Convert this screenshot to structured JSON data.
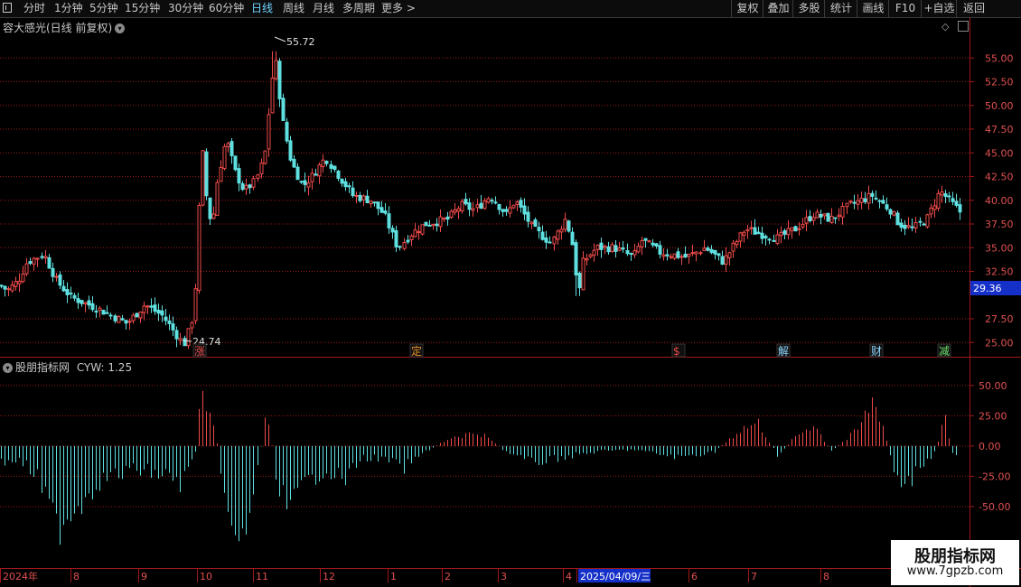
{
  "toolbar": {
    "periods": [
      "分时",
      "1分钟",
      "5分钟",
      "15分钟",
      "30分钟",
      "60分钟",
      "日线",
      "周线",
      "月线",
      "多周期",
      "更多 >"
    ],
    "active_period": "日线",
    "right_buttons": [
      "复权",
      "叠加",
      "多股",
      "统计",
      "画线",
      "F10",
      "+自选",
      "返回"
    ]
  },
  "main_panel": {
    "title": "容大感光(日线 前复权)",
    "high_label": "55.72",
    "low_label": "24.74",
    "current_price": "29.36",
    "y_ticks": [
      "55.00",
      "52.50",
      "50.00",
      "47.50",
      "45.00",
      "42.50",
      "40.00",
      "37.50",
      "35.00",
      "32.50",
      "27.50",
      "25.00"
    ],
    "events": [
      {
        "label": "涨",
        "color": "#e84a4a"
      },
      {
        "label": "定",
        "color": "#e8902a"
      },
      {
        "label": "$",
        "color": "#e84a4a"
      },
      {
        "label": "解",
        "color": "#8ed8ff"
      },
      {
        "label": "财",
        "color": "#8ed8ff"
      },
      {
        "label": "减",
        "color": "#6ce46c"
      }
    ]
  },
  "indicator_panel": {
    "title": "股朋指标网",
    "value_label": "CYW: 1.25",
    "y_ticks": [
      "50.00",
      "25.00",
      "0.00",
      "-25.00",
      "-50.00"
    ]
  },
  "time_axis": {
    "labels": [
      "2024年",
      "8",
      "9",
      "10",
      "11",
      "12",
      "1",
      "2",
      "3",
      "4",
      "2025/04/09/三",
      "6",
      "7",
      "8"
    ],
    "highlight": "2025/04/09/三"
  },
  "logo": {
    "line1": "股朋指标网",
    "line2": "www.7gpzb.com"
  },
  "colors": {
    "up": "#f04a4a",
    "down": "#5fe0e0",
    "grid": "#a01818",
    "highlight_bg": "#1530c8"
  },
  "chart_data": {
    "type": "candlestick",
    "price_ylim": [
      23.5,
      57.5
    ],
    "indicator_ylim": [
      -100,
      70
    ],
    "key_closes": [
      {
        "date": "2024-07",
        "value": 30.5
      },
      {
        "date": "2024-07",
        "value": 34.3
      },
      {
        "date": "2024-09-20",
        "value": 24.74
      },
      {
        "date": "2024-10-10",
        "value": 47.5
      },
      {
        "date": "2024-11-08",
        "value": 55.72
      },
      {
        "date": "2025-01-13",
        "value": 35.0
      },
      {
        "date": "2025-03-03",
        "value": 42.0
      },
      {
        "date": "2025-04-09",
        "value": 30.0
      },
      {
        "date": "2025-08",
        "value": 42.0
      }
    ]
  }
}
